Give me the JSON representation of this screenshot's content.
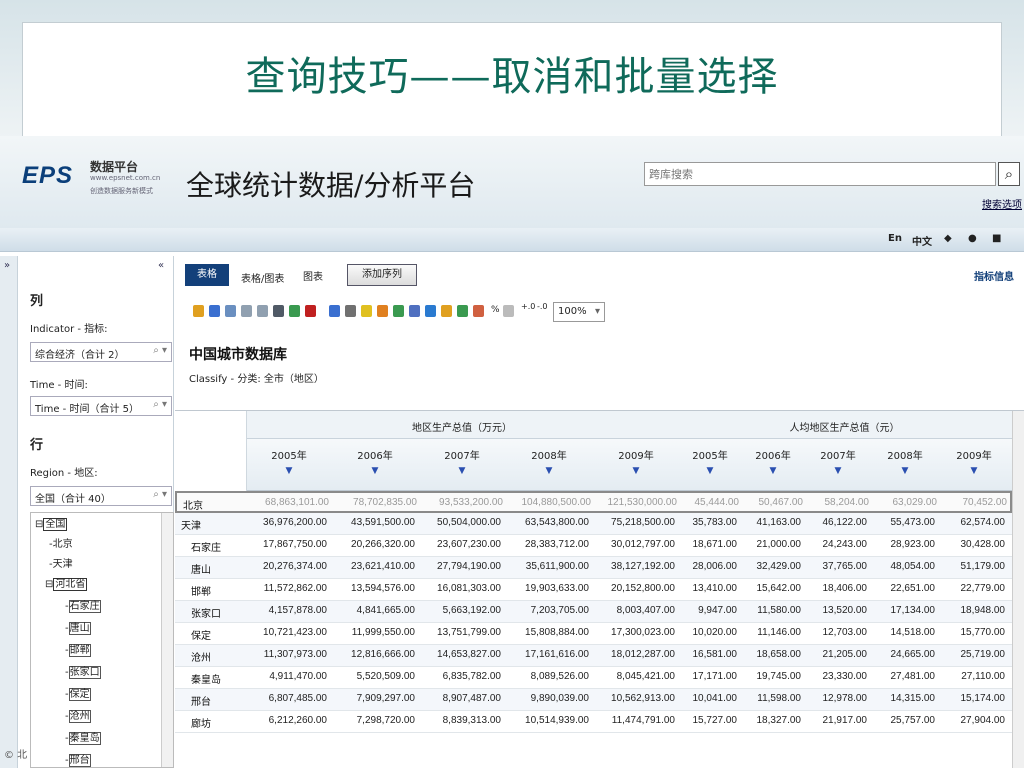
{
  "slide": {
    "title": "查询技巧——取消和批量选择"
  },
  "header": {
    "logo": "EPS",
    "logo_sub": "数据平台",
    "logo_url": "www.epsnet.com.cn",
    "logo_tag": "创造数据服务新模式",
    "platform_title": "全球统计数据/分析平台",
    "search_placeholder": "跨库搜索",
    "search_options": "搜索选项"
  },
  "topbar": {
    "en": "En",
    "zh": "中文"
  },
  "left": {
    "column_section": "列",
    "indicator_label": "Indicator - 指标:",
    "indicator_value": "综合经济（合计 2）",
    "time_label": "Time - 时间:",
    "time_value": "Time - 时间（合计 5）",
    "row_section": "行",
    "region_label": "Region - 地区:",
    "region_value": "全国（合计 40）",
    "tree": [
      "全国",
      "北京",
      "天津",
      "河北省",
      "石家庄",
      "唐山",
      "邯郸",
      "张家口",
      "保定",
      "沧州",
      "秦皇岛",
      "邢台"
    ]
  },
  "main": {
    "tabs": [
      "表格",
      "表格/图表",
      "图表"
    ],
    "add_series": "添加序列",
    "indicator_info": "指标信息",
    "zoom": "100%",
    "db_title": "中国城市数据库",
    "classify": "Classify - 分类: 全市（地区）"
  },
  "table": {
    "groups": [
      "地区生产总值（万元）",
      "人均地区生产总值（元）"
    ],
    "years": [
      "2005年",
      "2006年",
      "2007年",
      "2008年",
      "2009年",
      "2005年",
      "2006年",
      "2007年",
      "2008年",
      "2009年"
    ],
    "rows": [
      {
        "name": "北京",
        "values": [
          "68,863,101.00",
          "78,702,835.00",
          "93,533,200.00",
          "104,880,500.00",
          "121,530,000.00",
          "45,444.00",
          "50,467.00",
          "58,204.00",
          "63,029.00",
          "70,452.00"
        ]
      },
      {
        "name": "天津",
        "values": [
          "36,976,200.00",
          "43,591,500.00",
          "50,504,000.00",
          "63,543,800.00",
          "75,218,500.00",
          "35,783.00",
          "41,163.00",
          "46,122.00",
          "55,473.00",
          "62,574.00"
        ]
      },
      {
        "name": "石家庄",
        "values": [
          "17,867,750.00",
          "20,266,320.00",
          "23,607,230.00",
          "28,383,712.00",
          "30,012,797.00",
          "18,671.00",
          "21,000.00",
          "24,243.00",
          "28,923.00",
          "30,428.00"
        ]
      },
      {
        "name": "唐山",
        "values": [
          "20,276,374.00",
          "23,621,410.00",
          "27,794,190.00",
          "35,611,900.00",
          "38,127,192.00",
          "28,006.00",
          "32,429.00",
          "37,765.00",
          "48,054.00",
          "51,179.00"
        ]
      },
      {
        "name": "邯郸",
        "values": [
          "11,572,862.00",
          "13,594,576.00",
          "16,081,303.00",
          "19,903,633.00",
          "20,152,800.00",
          "13,410.00",
          "15,642.00",
          "18,406.00",
          "22,651.00",
          "22,779.00"
        ]
      },
      {
        "name": "张家口",
        "values": [
          "4,157,878.00",
          "4,841,665.00",
          "5,663,192.00",
          "7,203,705.00",
          "8,003,407.00",
          "9,947.00",
          "11,580.00",
          "13,520.00",
          "17,134.00",
          "18,948.00"
        ]
      },
      {
        "name": "保定",
        "values": [
          "10,721,423.00",
          "11,999,550.00",
          "13,751,799.00",
          "15,808,884.00",
          "17,300,023.00",
          "10,020.00",
          "11,146.00",
          "12,703.00",
          "14,518.00",
          "15,770.00"
        ]
      },
      {
        "name": "沧州",
        "values": [
          "11,307,973.00",
          "12,816,666.00",
          "14,653,827.00",
          "17,161,616.00",
          "18,012,287.00",
          "16,581.00",
          "18,658.00",
          "21,205.00",
          "24,665.00",
          "25,719.00"
        ]
      },
      {
        "name": "秦皇岛",
        "values": [
          "4,911,470.00",
          "5,520,509.00",
          "6,835,782.00",
          "8,089,526.00",
          "8,045,421.00",
          "17,171.00",
          "19,745.00",
          "23,330.00",
          "27,481.00",
          "27,110.00"
        ]
      },
      {
        "name": "邢台",
        "values": [
          "6,807,485.00",
          "7,909,297.00",
          "8,907,487.00",
          "9,890,039.00",
          "10,562,913.00",
          "10,041.00",
          "11,598.00",
          "12,978.00",
          "14,315.00",
          "15,174.00"
        ]
      },
      {
        "name": "廊坊",
        "values": [
          "6,212,260.00",
          "7,298,720.00",
          "8,839,313.00",
          "10,514,939.00",
          "11,474,791.00",
          "15,727.00",
          "18,327.00",
          "21,917.00",
          "25,757.00",
          "27,904.00"
        ]
      }
    ]
  },
  "footer": {
    "mark": "© 北"
  }
}
